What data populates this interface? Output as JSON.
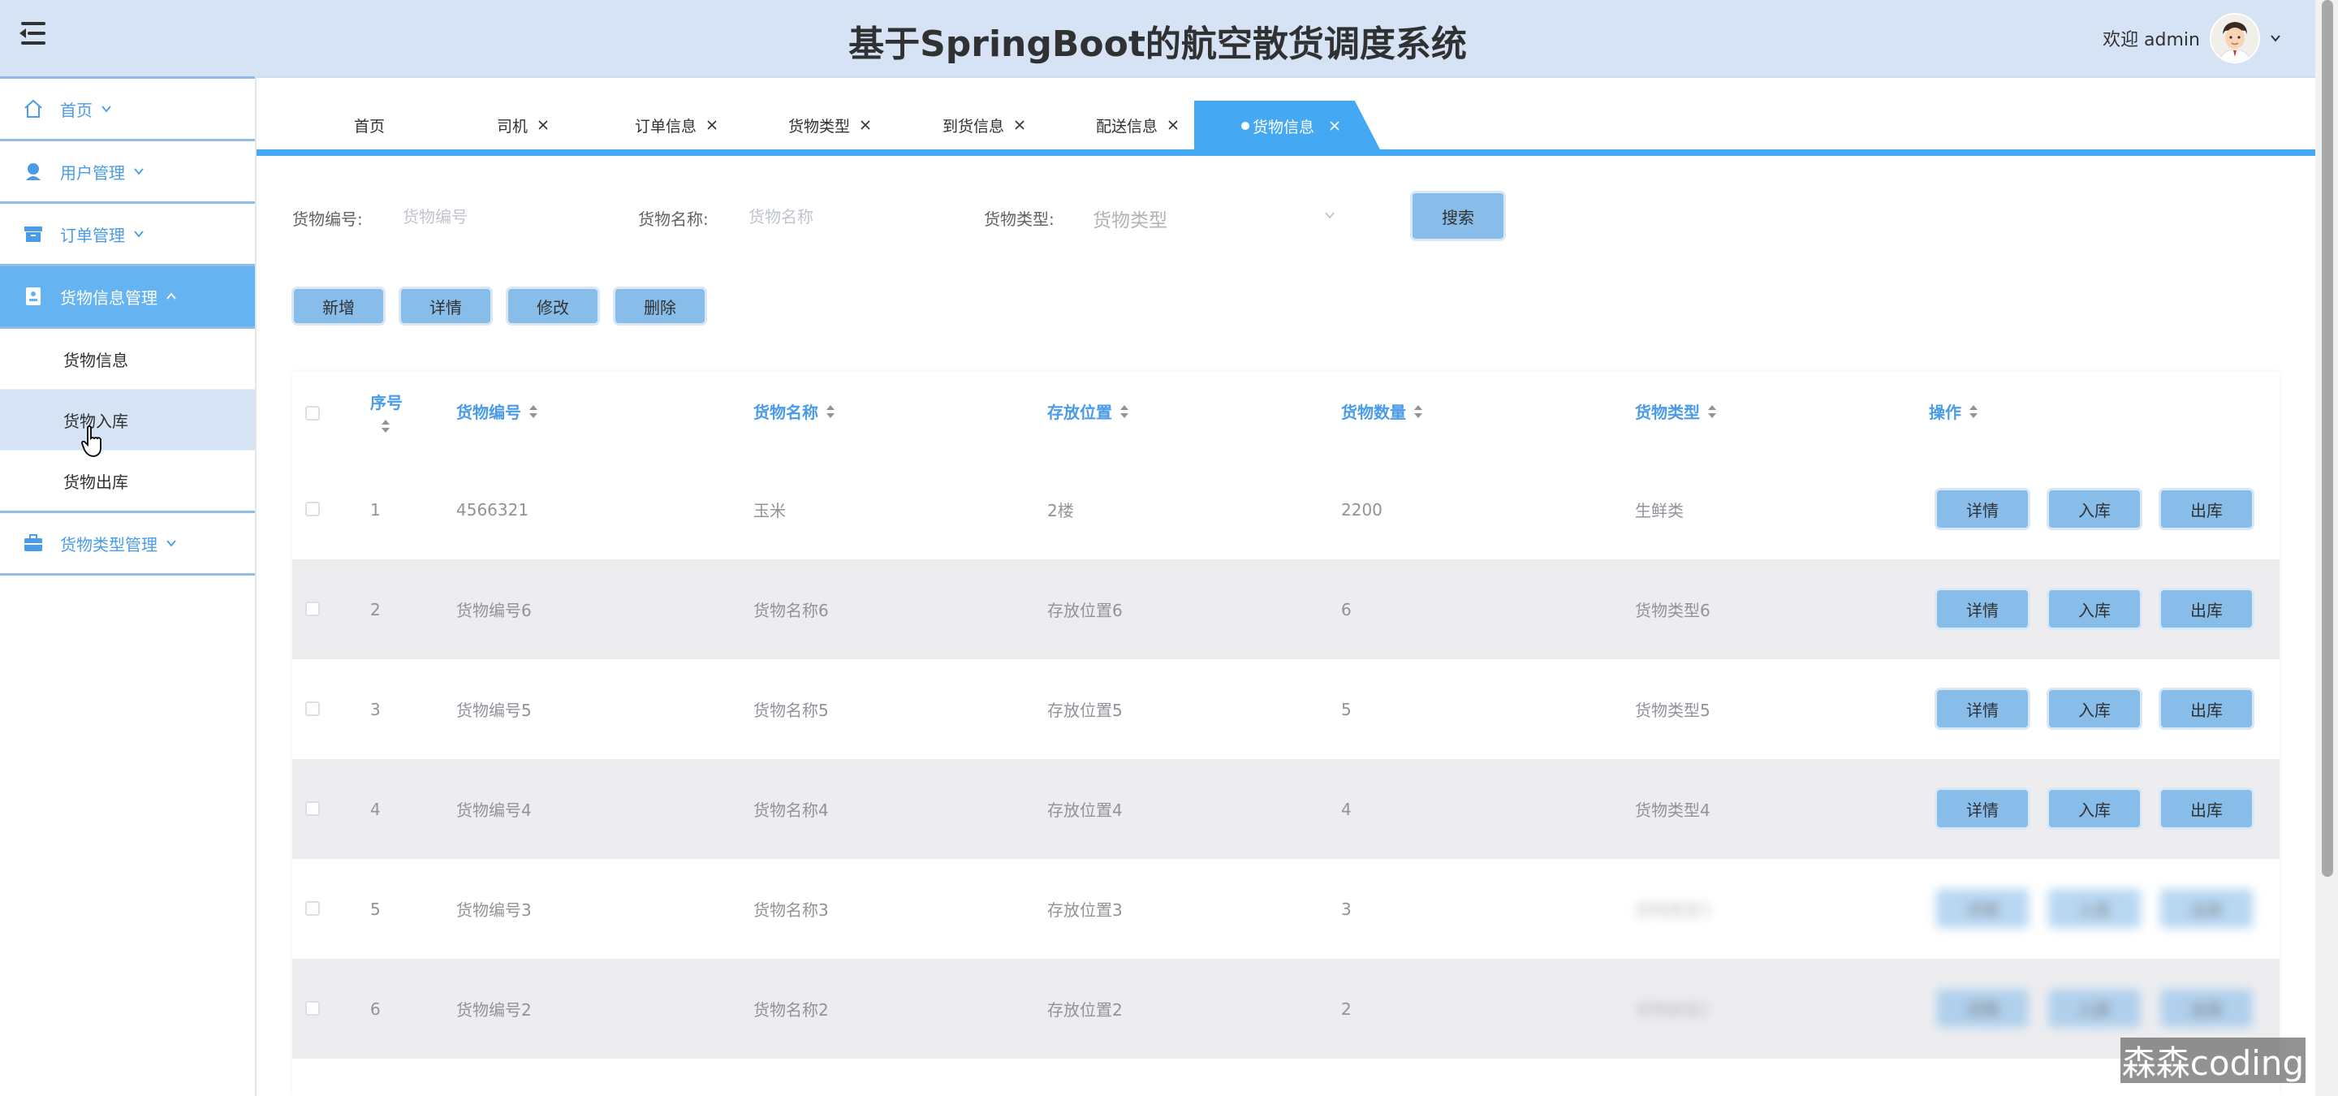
{
  "header": {
    "title": "基于SpringBoot的航空散货调度系统",
    "welcome": "欢迎 admin",
    "menu_toggle_icon": "hamburger-icon",
    "user_dropdown_icon": "chevron-down-icon"
  },
  "sidebar": {
    "items": [
      {
        "label": "首页",
        "icon": "home-icon"
      },
      {
        "label": "用户管理",
        "icon": "user-icon"
      },
      {
        "label": "订单管理",
        "icon": "archive-icon"
      },
      {
        "label": "货物信息管理",
        "icon": "document-icon"
      },
      {
        "label": "货物类型管理",
        "icon": "briefcase-icon"
      }
    ],
    "submenu": [
      {
        "label": "货物信息"
      },
      {
        "label": "货物入库"
      },
      {
        "label": "货物出库"
      }
    ]
  },
  "tabs": [
    {
      "label": "首页",
      "closable": false
    },
    {
      "label": "司机",
      "closable": true
    },
    {
      "label": "订单信息",
      "closable": true
    },
    {
      "label": "货物类型",
      "closable": true
    },
    {
      "label": "到货信息",
      "closable": true
    },
    {
      "label": "配送信息",
      "closable": true
    },
    {
      "label": "货物信息",
      "closable": true,
      "active": true
    }
  ],
  "search": {
    "code_label": "货物编号:",
    "code_placeholder": "货物编号",
    "name_label": "货物名称:",
    "name_placeholder": "货物名称",
    "type_label": "货物类型:",
    "type_placeholder": "货物类型",
    "search_button": "搜索"
  },
  "actions": {
    "add": "新增",
    "detail": "详情",
    "edit": "修改",
    "delete": "删除"
  },
  "table": {
    "columns": [
      "序号",
      "货物编号",
      "货物名称",
      "存放位置",
      "货物数量",
      "货物类型",
      "操作"
    ],
    "rows": [
      {
        "index": "1",
        "code": "4566321",
        "name": "玉米",
        "location": "2楼",
        "quantity": "2200",
        "type": "生鲜类"
      },
      {
        "index": "2",
        "code": "货物编号6",
        "name": "货物名称6",
        "location": "存放位置6",
        "quantity": "6",
        "type": "货物类型6"
      },
      {
        "index": "3",
        "code": "货物编号5",
        "name": "货物名称5",
        "location": "存放位置5",
        "quantity": "5",
        "type": "货物类型5"
      },
      {
        "index": "4",
        "code": "货物编号4",
        "name": "货物名称4",
        "location": "存放位置4",
        "quantity": "4",
        "type": "货物类型4"
      },
      {
        "index": "5",
        "code": "货物编号3",
        "name": "货物名称3",
        "location": "存放位置3",
        "quantity": "3",
        "type": "货物类型3"
      },
      {
        "index": "6",
        "code": "货物编号2",
        "name": "货物名称2",
        "location": "存放位置2",
        "quantity": "2",
        "type": "货物类型2"
      }
    ],
    "row_actions": {
      "detail": "详情",
      "in": "入库",
      "out": "出库"
    }
  },
  "watermark": "森森coding",
  "colors": {
    "header_bg": "#d6e3f5",
    "accent": "#45a8f2",
    "button": "#88bdea",
    "menu_text": "#4a9be8"
  }
}
